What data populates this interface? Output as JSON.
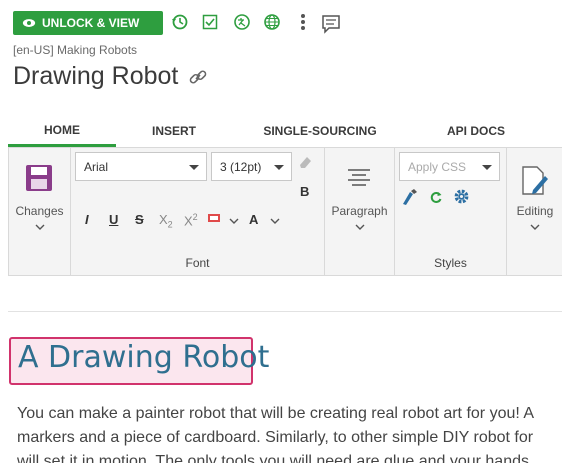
{
  "toolbar": {
    "unlock_label": "UNLOCK & VIEW"
  },
  "breadcrumb": "[en-US] Making Robots",
  "page_title": "Drawing Robot",
  "tabs": [
    {
      "label": "HOME"
    },
    {
      "label": "INSERT"
    },
    {
      "label": "SINGLE-SOURCING"
    },
    {
      "label": "API DOCS"
    }
  ],
  "ribbon": {
    "changes_label": "Changes",
    "font_family": "Arial",
    "font_size": "3 (12pt)",
    "font_group_label": "Font",
    "paragraph_label": "Paragraph",
    "apply_css_placeholder": "Apply CSS",
    "styles_group_label": "Styles",
    "editing_label": "Editing",
    "bold_label": "B",
    "italic_label": "I",
    "underline_label": "U",
    "strike_label": "S",
    "subscript_label": "X",
    "subscript_mark": "2",
    "superscript_label": "X",
    "superscript_mark": "2",
    "font_color_label": "A"
  },
  "document": {
    "heading": "A Drawing Robot",
    "paragraph_lines": [
      "You can make a painter robot that will be creating real robot art for you! A",
      "markers and a piece of cardboard. Similarly, to other simple DIY robot for",
      "will set it in motion. The only tools you will need are glue and your hands"
    ]
  },
  "colors": {
    "accent": "#2e9e3f",
    "heading_border": "#d1336c",
    "heading_bg": "#fbe6ee",
    "heading_text": "#2f6f8f"
  }
}
